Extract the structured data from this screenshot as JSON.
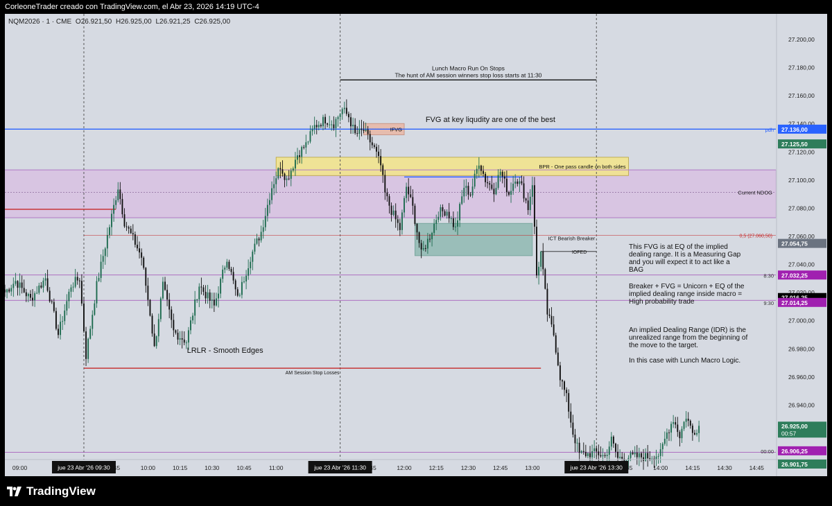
{
  "header": {
    "attribution": "CorleoneTrader creado con TradingView.com, el Abr 23, 2026 14:19 UTC-4"
  },
  "symbol_legend": {
    "symbol": "NQM2026 · 1 · CME",
    "open": "O26.921,50",
    "high": "H26.925,00",
    "low": "L26.921,25",
    "close": "C26.925,00"
  },
  "colors": {
    "background": "#d6dae2",
    "up_candle": "#1d6b4f",
    "down_candle": "#111111",
    "pdh_line": "#2962ff",
    "purple_zone": "#d8c4e2",
    "yellow_zone": "#f2e38e",
    "teal_zone": "#8fb9b1",
    "ifvg_zone": "#e8b8a8",
    "red_line": "#c62828",
    "price_tag_purple": "#a020b0",
    "price_tag_grey": "#6b7380",
    "price_tag_green": "#2e7d5b"
  },
  "chart_data": {
    "type": "candlestick",
    "symbol": "NQM2026",
    "timeframe": "1",
    "exchange": "CME",
    "ylim": [
      26901,
      27218
    ],
    "x_ticks": [
      "09:00",
      "09:30",
      ":45",
      "10:00",
      "10:15",
      "10:30",
      "10:45",
      "11:00",
      "11:30",
      ":45",
      "12:00",
      "12:15",
      "12:30",
      "12:45",
      "13:00",
      "13:30",
      ":45",
      "14:00",
      "14:15",
      "14:30",
      "14:45"
    ],
    "time_range": [
      "08:53",
      "14:54"
    ],
    "time_markers": [
      "jue 23 Abr '26   09:30",
      "jue 23 Abr '26   11:30",
      "jue 23 Abr '26   13:30"
    ],
    "y_ticks": [
      "27.200,00",
      "27.180,00",
      "27.160,00",
      "27.140,00",
      "27.120,00",
      "27.100,00",
      "27.080,00",
      "27.060,00",
      "27.040,00",
      "27.020,00",
      "27.000,00",
      "26.980,00",
      "26.960,00",
      "26.940,00",
      "26.920,00"
    ],
    "price_tags": [
      {
        "label": "pdh",
        "value": "27.136,00",
        "color": "#2962ff"
      },
      {
        "label": "",
        "value": "27.125,50",
        "color": "#2e7d5b"
      },
      {
        "label": "Current NDOG",
        "value": "",
        "color": "#2e2e2e"
      },
      {
        "label": "0,5 (27.060,50)",
        "value": "",
        "color": "#c62828"
      },
      {
        "label": "",
        "value": "27.054,75",
        "color": "#6b7380"
      },
      {
        "label": "8:30",
        "value": "27.032,25",
        "color": "#a020b0"
      },
      {
        "label": "",
        "value": "27.016,25",
        "color": "#000000"
      },
      {
        "label": "9:30",
        "value": "27.014,25",
        "color": "#a020b0"
      },
      {
        "label": "",
        "value": "26.925,00",
        "color": "#2e7d5b"
      },
      {
        "label": "",
        "value": "00:57",
        "color": "#2e7d5b"
      },
      {
        "label": "00:00",
        "value": "26.906,25",
        "color": "#a020b0"
      },
      {
        "label": "",
        "value": "26.901,75",
        "color": "#2e7d5b"
      }
    ],
    "zones": [
      {
        "name": "Current NDOG",
        "from": "08:53",
        "to": "14:54",
        "low": 27073,
        "high": 27107
      },
      {
        "name": "BPR",
        "label": "BPR - One pass candle on both sides",
        "from": "11:00",
        "to": "13:45",
        "low": 27103,
        "high": 27116
      },
      {
        "name": "IFVG",
        "label": "IFVG",
        "from": "11:41",
        "to": "12:00",
        "low": 27132,
        "high": 27140
      },
      {
        "name": "ICT Bearish Breaker",
        "label": "ICT Bearish Breaker",
        "from": "12:05",
        "to": "13:00",
        "low": 27046,
        "high": 27069
      }
    ],
    "levels": [
      {
        "name": "pdh",
        "value": 27136,
        "from": "08:53",
        "to": "14:54"
      },
      {
        "name": "0,5",
        "value": 27060.5,
        "from": "09:30",
        "to": "14:54"
      },
      {
        "name": "8:30",
        "value": 27032.25,
        "from": "08:53",
        "to": "14:54"
      },
      {
        "name": "9:30",
        "value": 27014.25,
        "from": "08:53",
        "to": "14:54"
      },
      {
        "name": "00:00",
        "value": 26906.25,
        "from": "08:53",
        "to": "14:54"
      },
      {
        "name": "NDOG mid",
        "value": 27091,
        "from": "08:53",
        "to": "14:54"
      },
      {
        "name": "Lunch Macro",
        "value": 27171,
        "from": "11:30",
        "to": "13:30"
      },
      {
        "name": "AM Session Stop Losses",
        "value": 26966,
        "from": "09:30",
        "to": "13:04"
      },
      {
        "name": "red short",
        "value": 27079,
        "from": "08:53",
        "to": "09:45"
      },
      {
        "name": "blue short",
        "value": 27102,
        "from": "12:00",
        "to": "12:55"
      },
      {
        "name": "IOFED",
        "value": 27049,
        "from": "13:04",
        "to": "13:30"
      }
    ],
    "annotations": [
      {
        "text": "Lunch Macro Run On Stops"
      },
      {
        "text": "The hunt of AM session winners stop loss starts at 11:30"
      },
      {
        "text": "FVG at key liqudity are one of the best"
      },
      {
        "text": "LRLR - Smooth Edges"
      },
      {
        "text": "AM Session Stop Losses"
      },
      {
        "text": "IOFED"
      },
      {
        "text": "This FVG is at EQ of the implied"
      },
      {
        "text": "dealing range. It is a Measuring Gap"
      },
      {
        "text": "and you will expect it to act like a"
      },
      {
        "text": "BAG"
      },
      {
        "text": "Breaker + FVG = Unicorn + EQ of the"
      },
      {
        "text": "implied dealing range inside macro ="
      },
      {
        "text": "High probability trade"
      },
      {
        "text": "An implied Dealing Range (IDR) is the"
      },
      {
        "text": "unrealized range from the beginning of"
      },
      {
        "text": "the move to the target."
      },
      {
        "text": "In this case with Lunch Macro Logic."
      }
    ],
    "anchors": [
      {
        "t": "08:53",
        "p": 27020
      },
      {
        "t": "08:58",
        "p": 27028
      },
      {
        "t": "09:05",
        "p": 27015
      },
      {
        "t": "09:12",
        "p": 27030
      },
      {
        "t": "09:18",
        "p": 26990
      },
      {
        "t": "09:24",
        "p": 27025
      },
      {
        "t": "09:28",
        "p": 27030
      },
      {
        "t": "09:31",
        "p": 26975
      },
      {
        "t": "09:36",
        "p": 27025
      },
      {
        "t": "09:41",
        "p": 27060
      },
      {
        "t": "09:46",
        "p": 27095
      },
      {
        "t": "09:49",
        "p": 27070
      },
      {
        "t": "09:54",
        "p": 27055
      },
      {
        "t": "09:57",
        "p": 27045
      },
      {
        "t": "10:01",
        "p": 27005
      },
      {
        "t": "10:03",
        "p": 26980
      },
      {
        "t": "10:07",
        "p": 27025
      },
      {
        "t": "10:12",
        "p": 26992
      },
      {
        "t": "10:18",
        "p": 26985
      },
      {
        "t": "10:24",
        "p": 27025
      },
      {
        "t": "10:31",
        "p": 27010
      },
      {
        "t": "10:37",
        "p": 27045
      },
      {
        "t": "10:42",
        "p": 27015
      },
      {
        "t": "10:48",
        "p": 27045
      },
      {
        "t": "10:53",
        "p": 27063
      },
      {
        "t": "10:58",
        "p": 27095
      },
      {
        "t": "11:02",
        "p": 27110
      },
      {
        "t": "11:05",
        "p": 27100
      },
      {
        "t": "11:10",
        "p": 27118
      },
      {
        "t": "11:14",
        "p": 27125
      },
      {
        "t": "11:18",
        "p": 27138
      },
      {
        "t": "11:23",
        "p": 27143
      },
      {
        "t": "11:27",
        "p": 27140
      },
      {
        "t": "11:31",
        "p": 27150
      },
      {
        "t": "11:34",
        "p": 27145
      },
      {
        "t": "11:37",
        "p": 27132
      },
      {
        "t": "11:41",
        "p": 27135
      },
      {
        "t": "11:46",
        "p": 27122
      },
      {
        "t": "11:49",
        "p": 27110
      },
      {
        "t": "11:51",
        "p": 27090
      },
      {
        "t": "11:54",
        "p": 27078
      },
      {
        "t": "11:58",
        "p": 27065
      },
      {
        "t": "12:01",
        "p": 27095
      },
      {
        "t": "12:04",
        "p": 27080
      },
      {
        "t": "12:08",
        "p": 27047
      },
      {
        "t": "12:12",
        "p": 27060
      },
      {
        "t": "12:16",
        "p": 27077
      },
      {
        "t": "12:20",
        "p": 27078
      },
      {
        "t": "12:24",
        "p": 27065
      },
      {
        "t": "12:28",
        "p": 27095
      },
      {
        "t": "12:31",
        "p": 27090
      },
      {
        "t": "12:35",
        "p": 27113
      },
      {
        "t": "12:38",
        "p": 27100
      },
      {
        "t": "12:42",
        "p": 27093
      },
      {
        "t": "12:45",
        "p": 27106
      },
      {
        "t": "12:49",
        "p": 27090
      },
      {
        "t": "12:52",
        "p": 27102
      },
      {
        "t": "12:55",
        "p": 27095
      },
      {
        "t": "12:58",
        "p": 27080
      },
      {
        "t": "13:00",
        "p": 27098
      },
      {
        "t": "13:02",
        "p": 27032
      },
      {
        "t": "13:04",
        "p": 27048
      },
      {
        "t": "13:07",
        "p": 27005
      },
      {
        "t": "13:10",
        "p": 26990
      },
      {
        "t": "13:13",
        "p": 26960
      },
      {
        "t": "13:16",
        "p": 26945
      },
      {
        "t": "13:19",
        "p": 26920
      },
      {
        "t": "13:22",
        "p": 26905
      },
      {
        "t": "13:26",
        "p": 26905
      },
      {
        "t": "13:30",
        "p": 26906
      },
      {
        "t": "13:34",
        "p": 26903
      },
      {
        "t": "13:37",
        "p": 26915
      },
      {
        "t": "13:40",
        "p": 26902
      },
      {
        "t": "13:45",
        "p": 26903
      },
      {
        "t": "13:50",
        "p": 26903
      },
      {
        "t": "13:55",
        "p": 26903
      },
      {
        "t": "14:00",
        "p": 26905
      },
      {
        "t": "14:03",
        "p": 26920
      },
      {
        "t": "14:06",
        "p": 26930
      },
      {
        "t": "14:09",
        "p": 26918
      },
      {
        "t": "14:12",
        "p": 26932
      },
      {
        "t": "14:15",
        "p": 26920
      },
      {
        "t": "14:18",
        "p": 26925
      }
    ]
  },
  "footer": {
    "brand": "TradingView"
  }
}
